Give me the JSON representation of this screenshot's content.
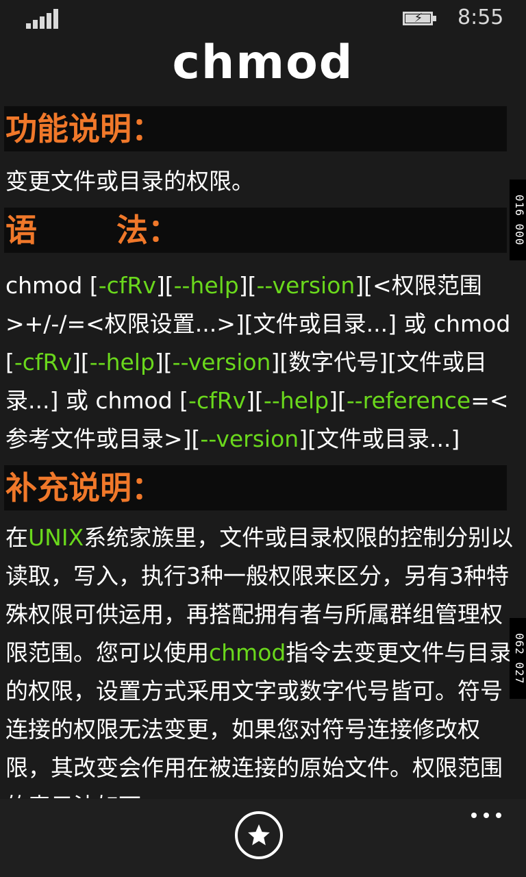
{
  "status": {
    "time": "8:55"
  },
  "page": {
    "title": "chmod"
  },
  "sections": {
    "function": {
      "heading": "功能说明：",
      "text": "变更文件或目录的权限。"
    },
    "syntax": {
      "heading_a": "语",
      "heading_b": "法：",
      "parts": [
        "chmod [",
        "-cfRv",
        "][",
        "--help",
        "][",
        "--version",
        "][<权限范围>+/-/=<权限设置...>][文件或目录...] 或 chmod [",
        "-cfRv",
        "][",
        "--help",
        "][",
        "--version",
        "][数字代号][文件或目录...] 或 chmod [",
        "-cfRv",
        "][",
        "--help",
        "][",
        "--reference",
        "=<参考文件或目录>][",
        "--version",
        "][文件或目录...]"
      ]
    },
    "notes": {
      "heading": "补充说明：",
      "parts": [
        "在",
        "UNIX",
        "系统家族里，文件或目录权限的控制分别以读取，写入，执行3种一般权限来区分，另有3种特殊权限可供运用，再搭配拥有者与所属群组管理权限范围。您可以使用",
        "chmod",
        "指令去变更文件与目录的权限，设置方式采用文字或数字代号皆可。符号连接的权限无法变更，如果您对符号连接修改权限，其改变会作用在被连接的原始文件。权限范围的表示法如下："
      ]
    }
  },
  "markers": [
    {
      "a": "016",
      "b": "000"
    },
    {
      "a": "062",
      "b": "027"
    }
  ],
  "appbar": {
    "favorite_icon": "star-icon",
    "more_icon": "ellipsis-icon"
  },
  "colors": {
    "heading": "#f0782a",
    "keyword": "#6ad81c",
    "background": "#1b1b1b"
  }
}
